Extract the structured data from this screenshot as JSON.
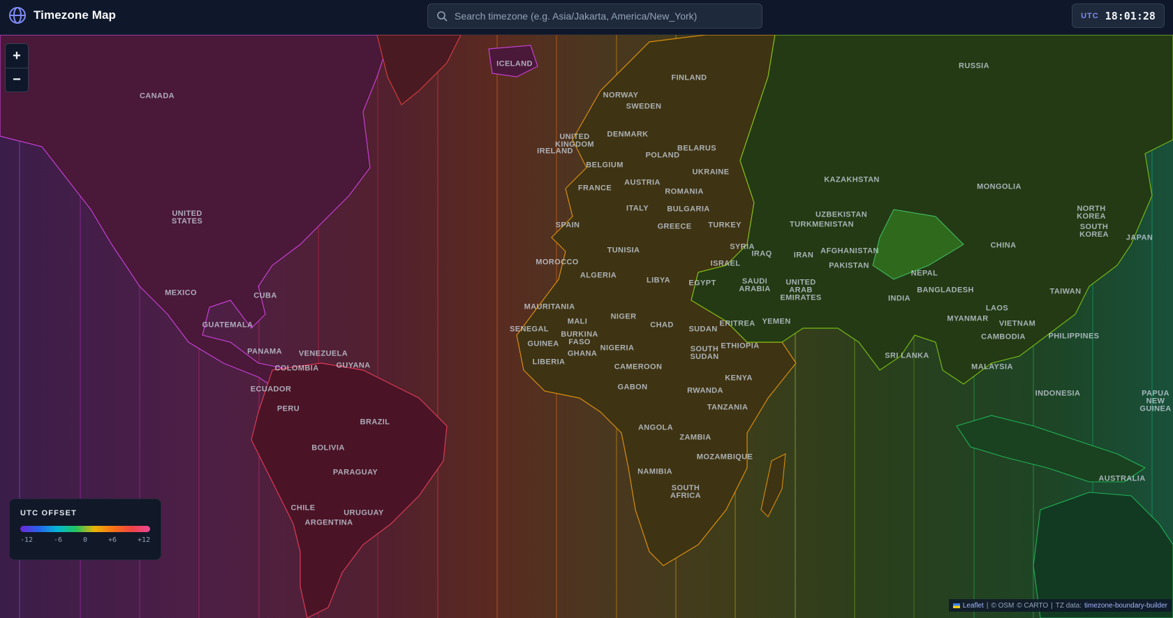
{
  "header": {
    "title": "Timezone Map",
    "search_placeholder": "Search timezone (e.g. Asia/Jakarta, America/New_York)",
    "clock_label": "UTC",
    "clock_time": "18:01:28"
  },
  "zoom": {
    "in_label": "+",
    "out_label": "−"
  },
  "legend": {
    "title": "UTC OFFSET",
    "ticks": [
      "-12",
      "-6",
      "0",
      "+6",
      "+12"
    ]
  },
  "attribution": {
    "leaflet": "Leaflet",
    "osm": "© OSM",
    "carto": "© CARTO",
    "tz_prefix": "TZ data:",
    "tz_source": "timezone-boundary-builder"
  },
  "colors": {
    "header_bg": "#0f172a",
    "accent": "#818cf8",
    "americas": "#7a2a5e",
    "europe_africa": "#6b5a1e",
    "asia": "#1f6b2a"
  },
  "countries": [
    "ICELAND",
    "RUSSIA",
    "FINLAND",
    "NORWAY",
    "SWEDEN",
    "CANADA",
    "DENMARK",
    "UNITED KINGDOM",
    "IRELAND",
    "BELARUS",
    "POLAND",
    "BELGIUM",
    "UKRAINE",
    "KAZAKHSTAN",
    "MONGOLIA",
    "AUSTRIA",
    "FRANCE",
    "ROMANIA",
    "BULGARIA",
    "ITALY",
    "UZBEKISTAN",
    "UNITED STATES",
    "SPAIN",
    "GREECE",
    "TURKEY",
    "TURKMENISTAN",
    "NORTH KOREA",
    "SOUTH KOREA",
    "JAPAN",
    "SYRIA",
    "CHINA",
    "TUNISIA",
    "IRAQ",
    "AFGHANISTAN",
    "IRAN",
    "ISRAEL",
    "PAKISTAN",
    "MOROCCO",
    "NEPAL",
    "ALGERIA",
    "LIBYA",
    "EGYPT",
    "SAUDI ARABIA",
    "UNITED ARAB EMIRATES",
    "MEXICO",
    "BANGLADESH",
    "TAIWAN",
    "CUBA",
    "INDIA",
    "MAURITANIA",
    "LAOS",
    "NIGER",
    "MYANMAR",
    "MALI",
    "CHAD",
    "ERITREA",
    "YEMEN",
    "VIETNAM",
    "GUATEMALA",
    "SENEGAL",
    "SUDAN",
    "PHILIPPINES",
    "BURKINA FASO",
    "CAMBODIA",
    "GUINEA",
    "ETHIOPIA",
    "NIGERIA",
    "PANAMA",
    "VENEZUELA",
    "GHANA",
    "SOUTH SUDAN",
    "SRI LANKA",
    "GUYANA",
    "LIBERIA",
    "MALAYSIA",
    "COLOMBIA",
    "CAMEROON",
    "KENYA",
    "GABON",
    "ECUADOR",
    "RWANDA",
    "INDONESIA",
    "PAPUA NEW GUINEA",
    "TANZANIA",
    "PERU",
    "BRAZIL",
    "ANGOLA",
    "ZAMBIA",
    "BOLIVIA",
    "MOZAMBIQUE",
    "NAMIBIA",
    "PARAGUAY",
    "AUSTRALIA",
    "SOUTH AFRICA",
    "URUGUAY",
    "CHILE",
    "ARGENTINA"
  ]
}
